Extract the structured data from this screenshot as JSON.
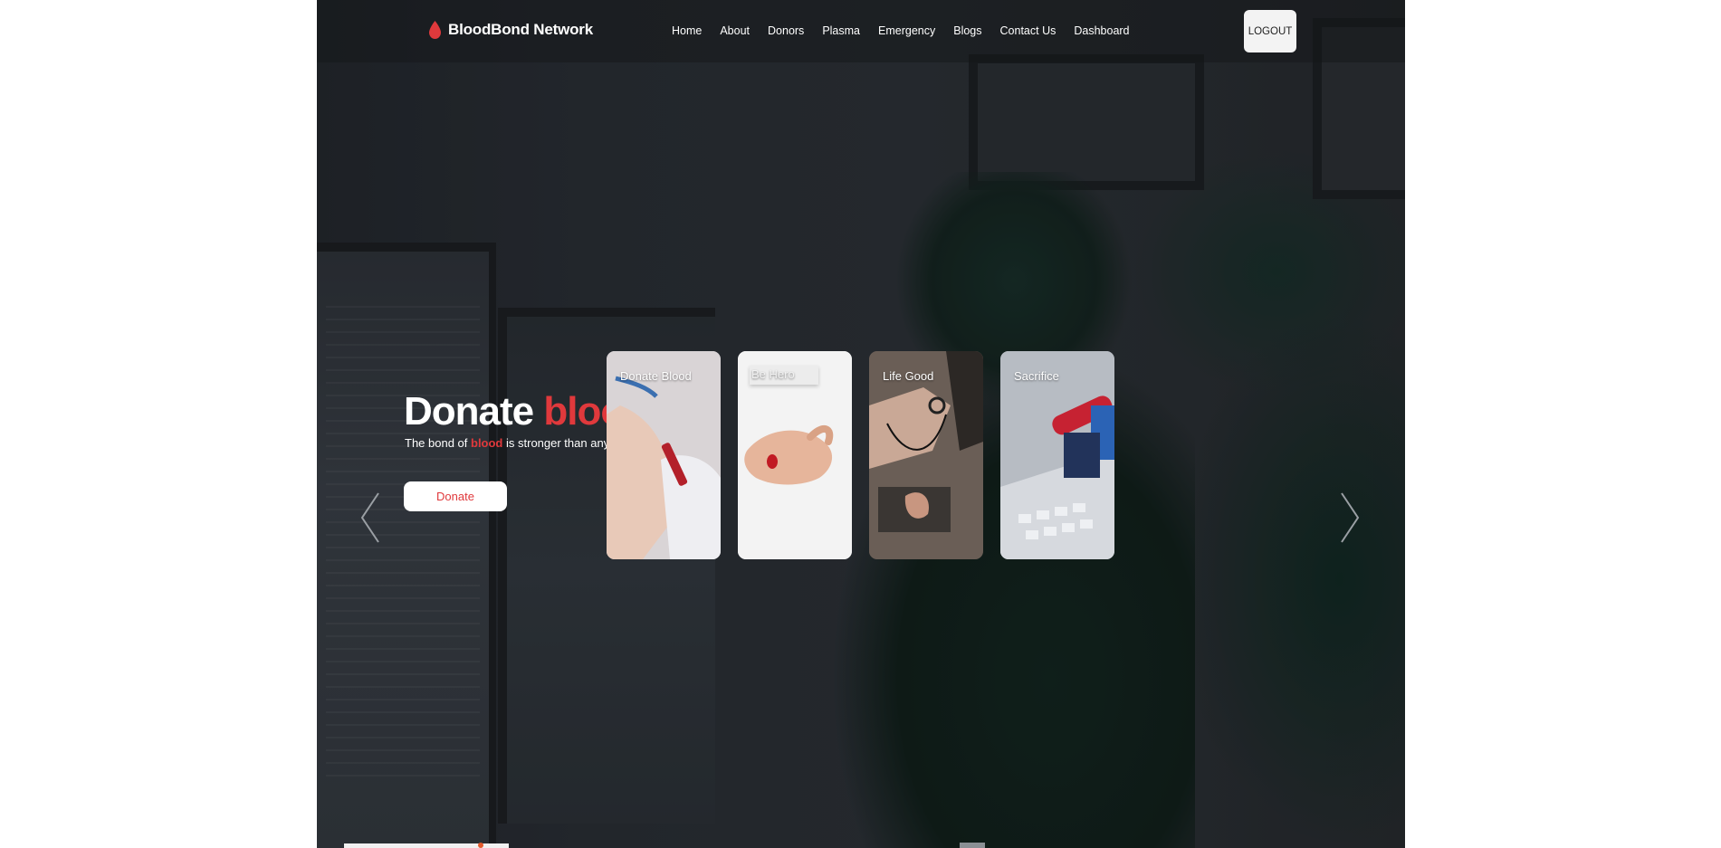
{
  "brand": {
    "name": "BloodBond Network",
    "icon": "blood-drop-icon",
    "accent": "#e0393c"
  },
  "nav": {
    "items": [
      {
        "label": "Home"
      },
      {
        "label": "About"
      },
      {
        "label": "Donors"
      },
      {
        "label": "Plasma"
      },
      {
        "label": "Emergency"
      },
      {
        "label": "Blogs"
      },
      {
        "label": "Contact Us"
      },
      {
        "label": "Dashboard"
      }
    ],
    "logout_label": "LOGOUT"
  },
  "hero": {
    "title_main": "Donate ",
    "title_accent": "blood",
    "title_end": ".",
    "subtitle_before": "The bond of ",
    "subtitle_accent": "blood",
    "subtitle_after": " is stronger than anything.",
    "cta_label": "Donate"
  },
  "cards": [
    {
      "label": "Donate Blood"
    },
    {
      "label": "Be Hero"
    },
    {
      "label": "Life Good"
    },
    {
      "label": "Sacrifice"
    }
  ],
  "carousel": {
    "prev_icon": "chevron-left-icon",
    "next_icon": "chevron-right-icon"
  },
  "colors": {
    "accent": "#e0393c",
    "nav_bg": "#141618",
    "button_bg": "#ffffff"
  }
}
